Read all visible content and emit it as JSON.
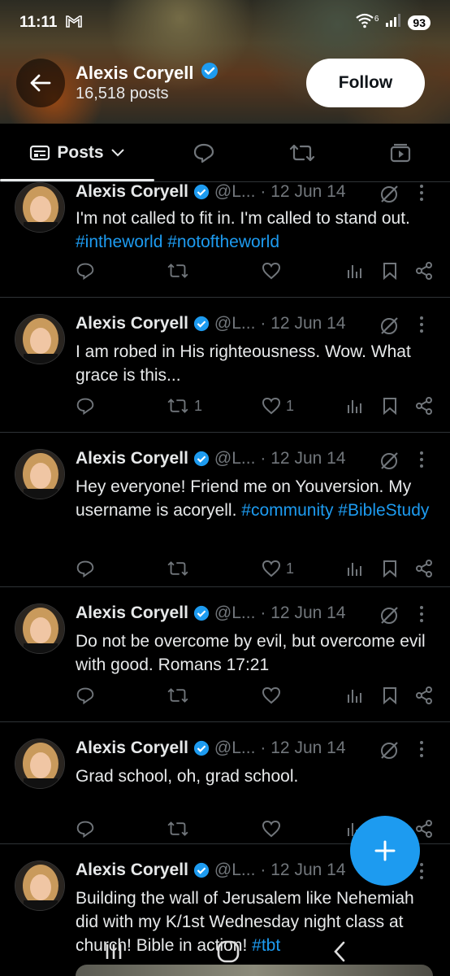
{
  "status": {
    "time": "11:11",
    "battery": "93",
    "signal_label": "6"
  },
  "profile": {
    "name": "Alexis Coryell",
    "posts_count": "16,518 posts",
    "follow_label": "Follow"
  },
  "tabs": {
    "posts_label": "Posts"
  },
  "colors": {
    "accent": "#1d9bf0",
    "verified": "#1d9bf0",
    "text_muted": "#71767b"
  },
  "posts": [
    {
      "name": "Alexis Coryell",
      "handle": "@L...",
      "date": "· 12 Jun 14",
      "text": "I'm not called to fit in. I'm called to stand out.",
      "tags": "#intheworld #notoftheworld",
      "retweets": "",
      "likes": ""
    },
    {
      "name": "Alexis Coryell",
      "handle": "@L...",
      "date": "· 12 Jun 14",
      "text": "I am robed in His righteousness. Wow. What grace is this...",
      "tags": "",
      "retweets": "1",
      "likes": "1"
    },
    {
      "name": "Alexis Coryell",
      "handle": "@L...",
      "date": "· 12 Jun 14",
      "text": "Hey everyone! Friend me on Youversion. My username is acoryell.",
      "tags": "#community #BibleStudy",
      "retweets": "",
      "likes": "1"
    },
    {
      "name": "Alexis Coryell",
      "handle": "@L...",
      "date": "· 12 Jun 14",
      "text": "Do not be overcome by evil, but overcome evil with good. Romans 17:21",
      "tags": "",
      "retweets": "",
      "likes": ""
    },
    {
      "name": "Alexis Coryell",
      "handle": "@L...",
      "date": "· 12 Jun 14",
      "text": "Grad school, oh, grad school.",
      "tags": "",
      "retweets": "",
      "likes": ""
    },
    {
      "name": "Alexis Coryell",
      "handle": "@L...",
      "date": "· 12 Jun 14",
      "text": "Building the wall of Jerusalem like Nehemiah did with my K/1st Wednesday night class at church! Bible in action!",
      "tags": "#tbt",
      "retweets": "",
      "likes": ""
    }
  ]
}
